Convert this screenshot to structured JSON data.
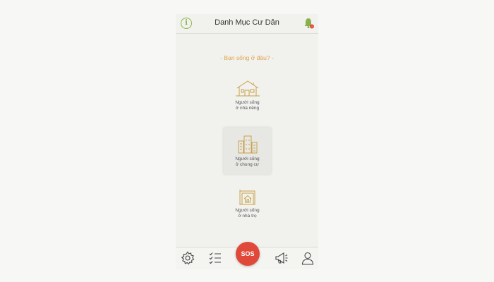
{
  "header": {
    "title": "Danh Mục Cư Dân",
    "info_icon_glyph": "i"
  },
  "question": "- Bạn sống ở đâu? -",
  "options": [
    {
      "line1": "Người sống",
      "line2": "ở nhà riêng",
      "icon": "house-icon"
    },
    {
      "line1": "Người sống",
      "line2": "ở chung cư",
      "icon": "apartment-icon",
      "selected": true
    },
    {
      "line1": "Người sống",
      "line2": "ở nhà trọ",
      "icon": "rental-room-icon"
    }
  ],
  "tabbar": {
    "sos_label": "SOS",
    "items": [
      "settings-icon",
      "checklist-icon",
      "sos-button",
      "megaphone-icon",
      "profile-icon"
    ]
  },
  "colors": {
    "accent_orange": "#e0a24c",
    "icon_gold": "#c9a04a",
    "green": "#8ab04a",
    "sos_red": "#e0493a",
    "notification_red": "#e0493a"
  }
}
